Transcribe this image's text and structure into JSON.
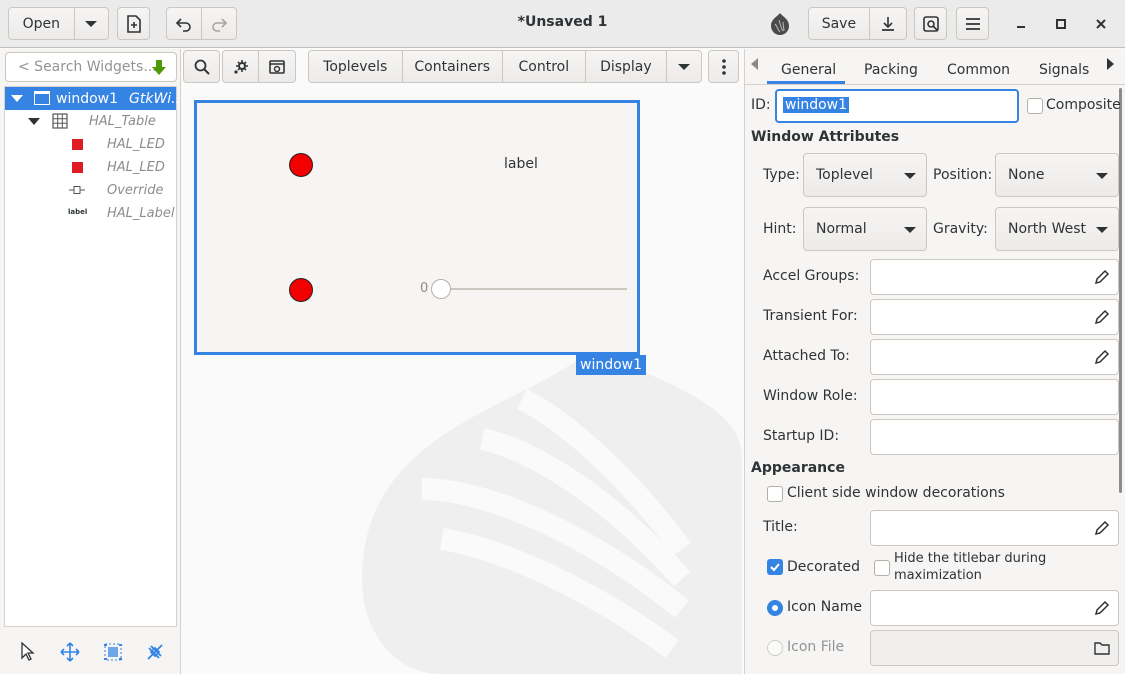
{
  "header": {
    "open_label": "Open",
    "title": "*Unsaved 1",
    "save_label": "Save"
  },
  "left": {
    "search_placeholder": "< Search Widgets...",
    "tree": [
      {
        "name": "window1",
        "type": "GtkWi..",
        "selected": true
      },
      {
        "name": "HAL_Table",
        "type": ""
      },
      {
        "name": "HAL_LED",
        "type": ""
      },
      {
        "name": "HAL_LED",
        "type": ""
      },
      {
        "name": "Override",
        "type": ""
      },
      {
        "name": "HAL_Label",
        "type": ""
      }
    ]
  },
  "palette": {
    "categories": [
      "Toplevels",
      "Containers",
      "Control",
      "Display"
    ]
  },
  "canvas": {
    "label_text": "label",
    "scale_value": "0",
    "window_name": "window1"
  },
  "props": {
    "tabs": [
      "General",
      "Packing",
      "Common",
      "Signals"
    ],
    "active_tab": "General",
    "id_label": "ID:",
    "id_value": "window1",
    "composite_label": "Composite",
    "section_window": "Window Attributes",
    "type_label": "Type:",
    "type_value": "Toplevel",
    "position_label": "Position:",
    "position_value": "None",
    "hint_label": "Hint:",
    "hint_value": "Normal",
    "gravity_label": "Gravity:",
    "gravity_value": "North West",
    "accel_label": "Accel Groups:",
    "transient_label": "Transient For:",
    "attached_label": "Attached To:",
    "role_label": "Window Role:",
    "startup_label": "Startup ID:",
    "section_appearance": "Appearance",
    "csd_label": "Client side window decorations",
    "title_label": "Title:",
    "decorated_label": "Decorated",
    "hide_titlebar_label_1": "Hide the titlebar during",
    "hide_titlebar_label_2": "maximization",
    "icon_name_label": "Icon Name",
    "icon_file_label": "Icon File"
  },
  "colors": {
    "accent": "#3584e4",
    "led": "#f20000"
  }
}
